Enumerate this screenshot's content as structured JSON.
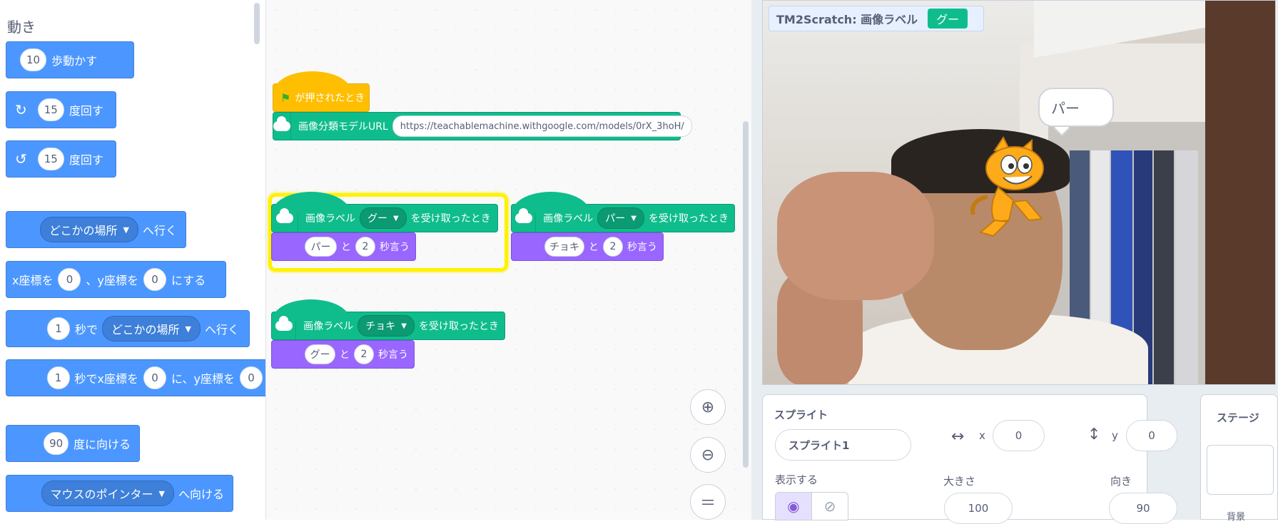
{
  "palette": {
    "category_title": "動き",
    "blocks": {
      "move": {
        "value": "10",
        "label": "歩動かす"
      },
      "turn_right": {
        "icon": "rotate-right-icon",
        "value": "15",
        "label": "度回す"
      },
      "turn_left": {
        "icon": "rotate-left-icon",
        "value": "15",
        "label": "度回す"
      },
      "goto": {
        "dropdown": "どこかの場所",
        "label": "へ行く"
      },
      "set_xy": {
        "label_x": "x座標を",
        "x": "0",
        "label_y": "、y座標を",
        "y": "0",
        "label_end": "にする"
      },
      "glide_to": {
        "value": "1",
        "label_sec": "秒で",
        "dropdown": "どこかの場所",
        "label": "へ行く"
      },
      "glide_xy": {
        "value": "1",
        "label_sec": "秒でx座標を",
        "x": "0",
        "label_y": "に、y座標を",
        "y": "0"
      },
      "point_direction": {
        "value": "90",
        "label": "度に向ける"
      },
      "point_towards": {
        "dropdown": "マウスのポインター",
        "label": "へ向ける"
      }
    }
  },
  "scripts": {
    "script1": {
      "hat_label": "が押されたとき",
      "model_label": "画像分類モデルURL",
      "model_url": "https://teachablemachine.withgoogle.com/models/0rX_3hoH/"
    },
    "script2": {
      "prefix": "画像ラベル",
      "label": "グー",
      "suffix": "を受け取ったとき",
      "say_text": "パー",
      "say_and": "と",
      "say_secs": "2",
      "say_suffix": "秒言う"
    },
    "script3": {
      "prefix": "画像ラベル",
      "label": "パー",
      "suffix": "を受け取ったとき",
      "say_text": "チョキ",
      "say_and": "と",
      "say_secs": "2",
      "say_suffix": "秒言う"
    },
    "script4": {
      "prefix": "画像ラベル",
      "label": "チョキ",
      "suffix": "を受け取ったとき",
      "say_text": "グー",
      "say_and": "と",
      "say_secs": "2",
      "say_suffix": "秒言う"
    }
  },
  "zoom": {
    "zoom_in_icon": "zoom-in-icon",
    "zoom_out_icon": "zoom-out-icon",
    "reset_icon": "zoom-reset-icon"
  },
  "stage": {
    "monitor_label": "TM2Scratch: 画像ラベル",
    "monitor_value": "グー",
    "speech": "パー"
  },
  "sprite_info": {
    "title": "スプライト",
    "name": "スプライト1",
    "x_label": "x",
    "x": "0",
    "y_label": "y",
    "y": "0",
    "show_label": "表示する",
    "size_label": "大きさ",
    "size": "100",
    "direction_label": "向き",
    "direction": "90"
  },
  "stage_panel": {
    "title": "ステージ",
    "backdrop_label": "背景"
  },
  "colors": {
    "motion": "#4c97ff",
    "events": "#ffbf00",
    "extension": "#0fbd8c",
    "looks": "#9966ff",
    "highlight": "#fff200"
  }
}
